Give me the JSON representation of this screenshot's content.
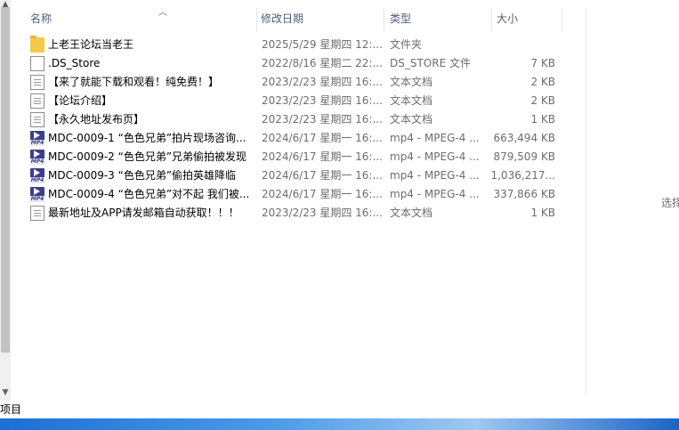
{
  "columns": {
    "name": "名称",
    "date": "修改日期",
    "type": "类型",
    "size": "大小"
  },
  "files": [
    {
      "icon": "folder-icon",
      "name": "上老王论坛当老王",
      "date": "2025/5/29 星期四 12:...",
      "type": "文件夹",
      "size": ""
    },
    {
      "icon": "blank-file-icon",
      "name": ".DS_Store",
      "date": "2022/8/16 星期二 22:...",
      "type": "DS_STORE 文件",
      "size": "7 KB"
    },
    {
      "icon": "text-file-icon",
      "name": "【来了就能下载和观看！纯免费！】",
      "date": "2023/2/23 星期四 16:...",
      "type": "文本文档",
      "size": "2 KB"
    },
    {
      "icon": "text-file-icon",
      "name": "【论坛介绍】",
      "date": "2023/2/23 星期四 16:...",
      "type": "文本文档",
      "size": "2 KB"
    },
    {
      "icon": "text-file-icon",
      "name": "【永久地址发布页】",
      "date": "2023/2/23 星期四 16:...",
      "type": "文本文档",
      "size": "1 KB"
    },
    {
      "icon": "mp4-file-icon",
      "name": "MDC-0009-1 “色色兄弟”拍片现场咨询...",
      "date": "2024/6/17 星期一 16:...",
      "type": "mp4 - MPEG-4 ...",
      "size": "663,494 KB"
    },
    {
      "icon": "mp4-file-icon",
      "name": "MDC-0009-2 “色色兄弟”兄弟偷拍被发现",
      "date": "2024/6/17 星期一 16:...",
      "type": "mp4 - MPEG-4 ...",
      "size": "879,509 KB"
    },
    {
      "icon": "mp4-file-icon",
      "name": "MDC-0009-3 “色色兄弟”偷拍英雄降临",
      "date": "2024/6/17 星期一 16:...",
      "type": "mp4 - MPEG-4 ...",
      "size": "1,036,217..."
    },
    {
      "icon": "mp4-file-icon",
      "name": "MDC-0009-4 “色色兄弟”对不起 我们被...",
      "date": "2024/6/17 星期一 16:...",
      "type": "mp4 - MPEG-4 ...",
      "size": "337,866 KB"
    },
    {
      "icon": "text-file-icon",
      "name": "最新地址及APP请发邮箱自动获取！！！",
      "date": "2023/2/23 星期四 16:...",
      "type": "文本文档",
      "size": "1 KB"
    }
  ],
  "preview_hint": "选择",
  "status": {
    "items_label": "项目"
  }
}
